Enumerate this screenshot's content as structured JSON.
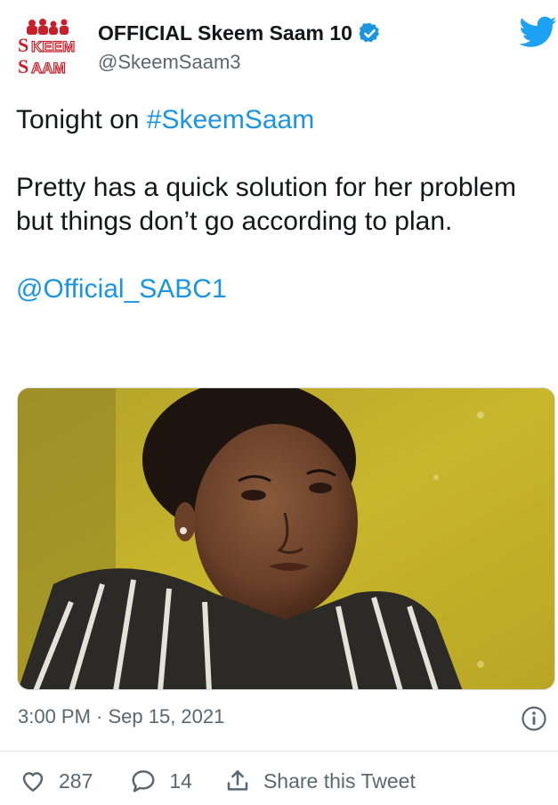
{
  "tweet": {
    "display_name": "OFFICIAL Skeem Saam 10",
    "handle": "@SkeemSaam3",
    "logo_text_line1": "SKEEM",
    "logo_text_line2": "SAAM",
    "text_prefix": "Tonight on ",
    "hashtag": "#SkeemSaam",
    "body": "Pretty has a quick solution for her problem but things don’t go according to plan.",
    "mention": "@Official_SABC1",
    "timestamp": "3:00 PM · Sep 15, 2021"
  },
  "actions": {
    "like_count": "287",
    "reply_count": "14",
    "share_label": "Share this Tweet"
  },
  "icons": {
    "verified": "verified-badge-icon",
    "bird": "twitter-bird-icon",
    "info": "info-icon",
    "like": "heart-icon",
    "reply": "reply-bubble-icon",
    "share": "share-icon"
  },
  "colors": {
    "link": "#1b95e0",
    "secondary_text": "#5b6770",
    "logo_red": "#c8202b"
  }
}
